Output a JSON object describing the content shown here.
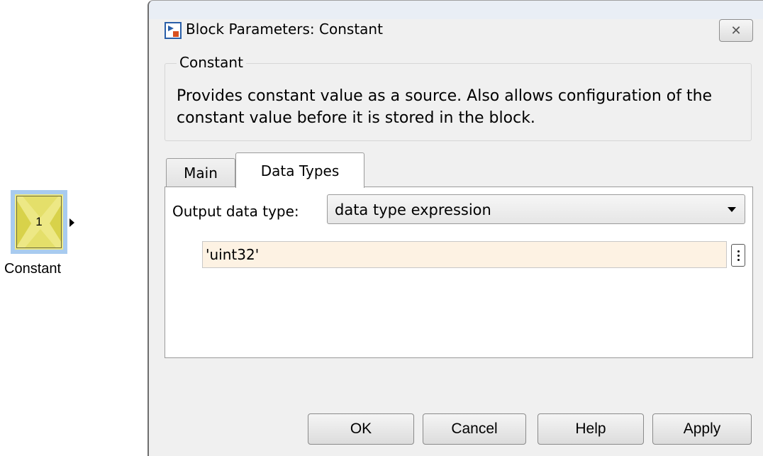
{
  "canvas": {
    "block": {
      "value": "1",
      "name": "Constant"
    }
  },
  "dialog": {
    "title": "Block Parameters: Constant",
    "close_symbol": "✕",
    "group_title": "Constant",
    "description": "Provides constant value as a source. Also allows configuration of the constant value before it is stored in the block.",
    "tabs": [
      {
        "label": "Main",
        "selected": false
      },
      {
        "label": "Data Types",
        "selected": true
      }
    ],
    "output_data_type": {
      "label": "Output data type:",
      "selected": "data type expression"
    },
    "expression_value": "'uint32'",
    "buttons": {
      "ok": "OK",
      "cancel": "Cancel",
      "help": "Help",
      "apply": "Apply"
    }
  },
  "icons": [
    "simulink-block-icon",
    "close-icon",
    "dropdown-arrow-icon",
    "more-options-icon",
    "output-port-icon"
  ],
  "colors": {
    "block_fill": "#ede885",
    "block_selection": "#a8cbef",
    "expression_bg": "#fdf2e3",
    "dialog_bg": "#f0f0f0"
  }
}
